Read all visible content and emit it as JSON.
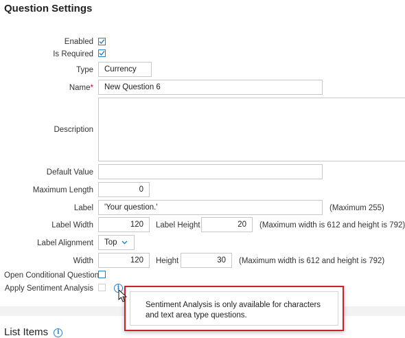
{
  "page_title": "Question Settings",
  "fields": {
    "enabled": {
      "label": "Enabled",
      "checked": true
    },
    "is_required": {
      "label": "Is Required",
      "checked": true
    },
    "type": {
      "label": "Type",
      "value": "Currency"
    },
    "name": {
      "label": "Name",
      "required_mark": "*",
      "value": "New Question 6"
    },
    "description": {
      "label": "Description",
      "value": ""
    },
    "default_value": {
      "label": "Default Value",
      "value": ""
    },
    "maximum_length": {
      "label": "Maximum Length",
      "value": "0"
    },
    "label": {
      "label": "Label",
      "value": "'Your question.'",
      "note": "(Maximum 255)"
    },
    "label_width": {
      "label": "Label Width",
      "value": "120"
    },
    "label_height": {
      "label": "Label Height",
      "value": "20"
    },
    "label_size_note": "(Maximum width is 612 and height is 792)",
    "label_alignment": {
      "label": "Label Alignment",
      "value": "Top"
    },
    "width": {
      "label": "Width",
      "value": "120"
    },
    "height": {
      "label": "Height",
      "value": "30"
    },
    "size_note": "(Maximum width is 612 and height is 792)",
    "open_conditional": {
      "label": "Open Conditional Question",
      "checked": false
    },
    "apply_sentiment": {
      "label": "Apply Sentiment Analysis",
      "checked": false
    }
  },
  "tooltip": {
    "text": "Sentiment Analysis is only available for characters and text area type questions."
  },
  "list_items": {
    "title": "List Items"
  },
  "colors": {
    "accent": "#2a7fc1",
    "required": "#d0021b",
    "tooltip_border": "#c9212e"
  },
  "icons": [
    "check-icon",
    "chevron-down-icon",
    "info-icon",
    "mouse-cursor-icon"
  ]
}
